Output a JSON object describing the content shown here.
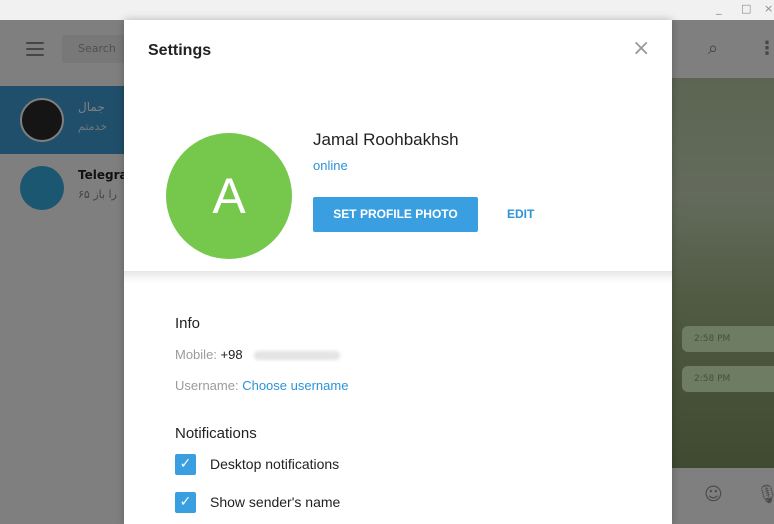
{
  "window": {
    "minimize": "_",
    "maximize": "□",
    "close": "×"
  },
  "background_app": {
    "search_placeholder": "Search",
    "chats": [
      {
        "name": "جمال",
        "preview": "خدمتم",
        "avatar_icon": "telegram-logo-icon"
      },
      {
        "name": "Telegra",
        "preview": "۶۵ را باز",
        "avatar_icon": "telegram-plane-icon"
      }
    ],
    "message_times": [
      "2:58 PM",
      "2:58 PM"
    ],
    "icons": {
      "search": "⌕",
      "more": "⋮",
      "emoji": "☺",
      "mic": "🎙"
    }
  },
  "settings": {
    "title": "Settings",
    "close_icon": "×",
    "profile": {
      "avatar_letter": "A",
      "avatar_color": "#76c84d",
      "name": "Jamal Roohbakhsh",
      "status": "online",
      "set_photo_label": "SET PROFILE PHOTO",
      "edit_label": "EDIT"
    },
    "info": {
      "heading": "Info",
      "mobile_label": "Mobile:",
      "mobile_value": "+98",
      "username_label": "Username:",
      "username_link": "Choose username"
    },
    "notifications": {
      "heading": "Notifications",
      "items": [
        {
          "label": "Desktop notifications",
          "checked": true
        },
        {
          "label": "Show sender's name",
          "checked": true
        }
      ]
    }
  },
  "colors": {
    "accent": "#3a9fe1",
    "link": "#2c93d8",
    "avatar": "#76c84d"
  }
}
